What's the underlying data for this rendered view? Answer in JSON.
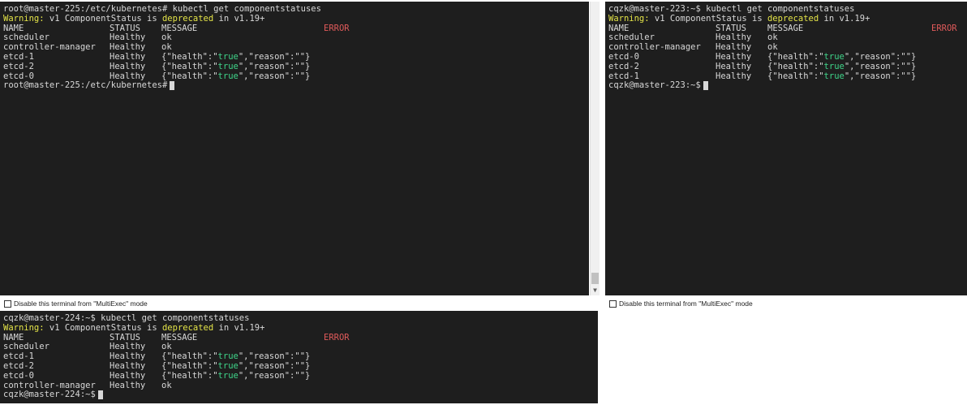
{
  "terminal_left": {
    "prompt_cmd": "root@master-225:/etc/kubernetes# kubectl get componentstatuses",
    "warn_label": "Warning:",
    "warn_mid": " v1 ComponentStatus is ",
    "warn_dep": "deprecated",
    "warn_end": " in v1.19+",
    "header": {
      "name": "NAME",
      "status": "STATUS",
      "message": "MESSAGE",
      "error": "ERROR"
    },
    "rows": [
      {
        "name": "scheduler",
        "status": "Healthy",
        "msg": "ok"
      },
      {
        "name": "controller-manager",
        "status": "Healthy",
        "msg": "ok"
      },
      {
        "name": "etcd-1",
        "status": "Healthy",
        "msg_a": "{\"health\":\"",
        "msg_b": "true",
        "msg_c": "\",\"reason\":\"\"}"
      },
      {
        "name": "etcd-2",
        "status": "Healthy",
        "msg_a": "{\"health\":\"",
        "msg_b": "true",
        "msg_c": "\",\"reason\":\"\"}"
      },
      {
        "name": "etcd-0",
        "status": "Healthy",
        "msg_a": "{\"health\":\"",
        "msg_b": "true",
        "msg_c": "\",\"reason\":\"\"}"
      }
    ],
    "final_prompt": "root@master-225:/etc/kubernetes#"
  },
  "terminal_right": {
    "prompt_cmd": "cqzk@master-223:~$ kubectl get componentstatuses",
    "warn_label": "Warning:",
    "warn_mid": " v1 ComponentStatus is ",
    "warn_dep": "deprecated",
    "warn_end": " in v1.19+",
    "header": {
      "name": "NAME",
      "status": "STATUS",
      "message": "MESSAGE",
      "error": "ERROR"
    },
    "rows": [
      {
        "name": "scheduler",
        "status": "Healthy",
        "msg": "ok"
      },
      {
        "name": "controller-manager",
        "status": "Healthy",
        "msg": "ok"
      },
      {
        "name": "etcd-0",
        "status": "Healthy",
        "msg_a": "{\"health\":\"",
        "msg_b": "true",
        "msg_c": "\",\"reason\":\"\"}"
      },
      {
        "name": "etcd-2",
        "status": "Healthy",
        "msg_a": "{\"health\":\"",
        "msg_b": "true",
        "msg_c": "\",\"reason\":\"\"}"
      },
      {
        "name": "etcd-1",
        "status": "Healthy",
        "msg_a": "{\"health\":\"",
        "msg_b": "true",
        "msg_c": "\",\"reason\":\"\"}"
      }
    ],
    "final_prompt": "cqzk@master-223:~$"
  },
  "terminal_bottom": {
    "prompt_cmd": "cqzk@master-224:~$ kubectl get componentstatuses",
    "warn_label": "Warning:",
    "warn_mid": " v1 ComponentStatus is ",
    "warn_dep": "deprecated",
    "warn_end": " in v1.19+",
    "header": {
      "name": "NAME",
      "status": "STATUS",
      "message": "MESSAGE",
      "error": "ERROR"
    },
    "rows": [
      {
        "name": "scheduler",
        "status": "Healthy",
        "msg": "ok"
      },
      {
        "name": "etcd-1",
        "status": "Healthy",
        "msg_a": "{\"health\":\"",
        "msg_b": "true",
        "msg_c": "\",\"reason\":\"\"}"
      },
      {
        "name": "etcd-2",
        "status": "Healthy",
        "msg_a": "{\"health\":\"",
        "msg_b": "true",
        "msg_c": "\",\"reason\":\"\"}"
      },
      {
        "name": "etcd-0",
        "status": "Healthy",
        "msg_a": "{\"health\":\"",
        "msg_b": "true",
        "msg_c": "\",\"reason\":\"\"}"
      },
      {
        "name": "controller-manager",
        "status": "Healthy",
        "msg": "ok"
      }
    ],
    "final_prompt": "cqzk@master-224:~$"
  },
  "multiexec_label": "Disable this terminal from \"MultiExec\" mode",
  "colors": {
    "background": "#1e1e1e",
    "text": "#d8d8d8",
    "warning": "#e4e448",
    "error": "#e05a5a",
    "true_value": "#3fd58a"
  }
}
